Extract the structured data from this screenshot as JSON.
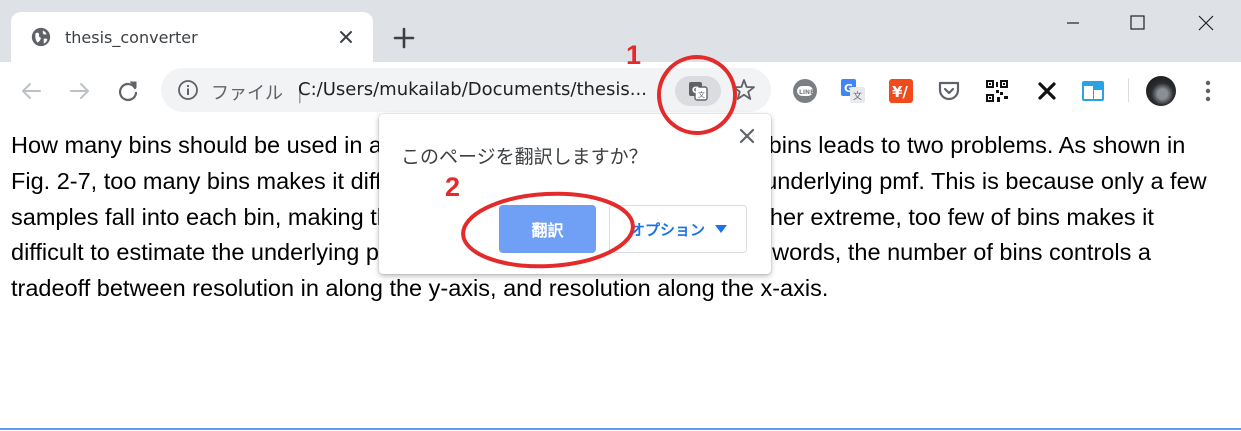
{
  "tab": {
    "title": "thesis_converter",
    "favicon": "globe-icon"
  },
  "window": {
    "controls": [
      "minimize-icon",
      "maximize-icon",
      "close-icon"
    ]
  },
  "toolbar": {
    "scheme_label": "ファイル",
    "separator": "|",
    "url": "C:/Users/mukailab/Documents/thesis...",
    "extensions": [
      "line-icon",
      "google-translate-icon",
      "yahoo-icon",
      "pocket-icon",
      "qr-code-icon",
      "x-icon",
      "window-icon"
    ]
  },
  "popup": {
    "title": "このページを翻訳しますか？",
    "translate_label": "翻訳",
    "options_label": "オプション"
  },
  "content": {
    "paragraph": "How many bins should be used in a histogram? Choosing the number of bins leads to two problems. As shown in Fig. 2-7, too many bins makes it difficult to estimate the amplitude of the underlying pmf. This is because only a few samples fall into each bin, making the statistical noise very high. At the other extreme, too few of bins makes it difficult to estimate the underlying pmf in the horizontal direction. In other words, the number of bins controls a tradeoff between resolution in along the y-axis, and resolution along the x-axis."
  },
  "annotations": {
    "step1": "1",
    "step2": "2"
  },
  "colors": {
    "accent": "#1a73e8",
    "translate_button": "#6fa0f5",
    "annotation": "#e32b2b",
    "tabstrip": "#dee1e6"
  }
}
